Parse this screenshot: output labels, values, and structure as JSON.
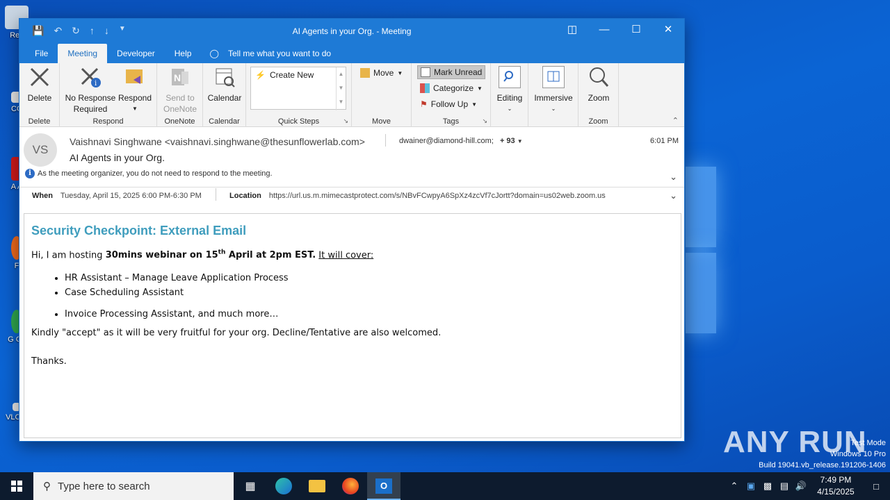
{
  "desktop": {
    "icons": [
      {
        "label": "Rec"
      },
      {
        "label": "CC"
      },
      {
        "label": "A A"
      },
      {
        "label": "F"
      },
      {
        "label": "G Ch"
      },
      {
        "label": "VLC P"
      }
    ],
    "watermark": {
      "line1": "Test Mode",
      "line2": "Windows 10 Pro",
      "line3": "Build 19041.vb_release.191206-1406"
    },
    "anyrun": "ANY RUN"
  },
  "window": {
    "title": "AI Agents in your Org.  -  Meeting",
    "tabs": [
      "File",
      "Meeting",
      "Developer",
      "Help"
    ],
    "active_tab": "Meeting",
    "tell_me": "Tell me what you want to do",
    "ribbon": {
      "delete": {
        "label": "Delete",
        "group": "Delete"
      },
      "respond_group": "Respond",
      "no_response": "No Response Required",
      "respond": "Respond",
      "onenote": {
        "label": "Send to OneNote",
        "group": "OneNote"
      },
      "calendar": {
        "label": "Calendar",
        "group": "Calendar"
      },
      "quick_steps": {
        "item": "Create New",
        "group": "Quick Steps"
      },
      "move": {
        "label": "Move",
        "group": "Move"
      },
      "tags": {
        "mark_unread": "Mark Unread",
        "categorize": "Categorize",
        "follow_up": "Follow Up",
        "group": "Tags"
      },
      "editing": "Editing",
      "immersive": "Immersive",
      "zoom": {
        "label": "Zoom",
        "group": "Zoom"
      }
    }
  },
  "message": {
    "avatar": "VS",
    "from": "Vaishnavi Singhwane <vaishnavi.singhwane@thesunflowerlab.com>",
    "to": "dwainer@diamond-hill.com;",
    "more_recipients": "+ 93",
    "time": "6:01 PM",
    "subject": "AI Agents in your Org.",
    "notice": "As the meeting organizer, you do not need to respond to the meeting.",
    "when_label": "When",
    "when": "Tuesday, April 15, 2025 6:00 PM-6:30 PM",
    "location_label": "Location",
    "location": "https://url.us.m.mimecastprotect.com/s/NBvFCwpyA6SpXz4zcVf7cJortt?domain=us02web.zoom.us"
  },
  "body": {
    "banner": "Security Checkpoint: External Email",
    "intro_start": "Hi, I am hosting ",
    "intro_bold1": "30mins webinar on 15",
    "intro_sup": "th",
    "intro_bold2": " April at 2pm EST.",
    "intro_underline": "It will cover:",
    "bullets": [
      "HR Assistant – Manage Leave Application Process",
      "Case Scheduling Assistant",
      "Invoice Processing Assistant, and much more…"
    ],
    "closing": "Kindly \"accept\" as it will be very fruitful for your org. Decline/Tentative are also welcomed.",
    "signoff": "Thanks."
  },
  "taskbar": {
    "search_placeholder": "Type here to search",
    "time": "7:49 PM",
    "date": "4/15/2025"
  }
}
